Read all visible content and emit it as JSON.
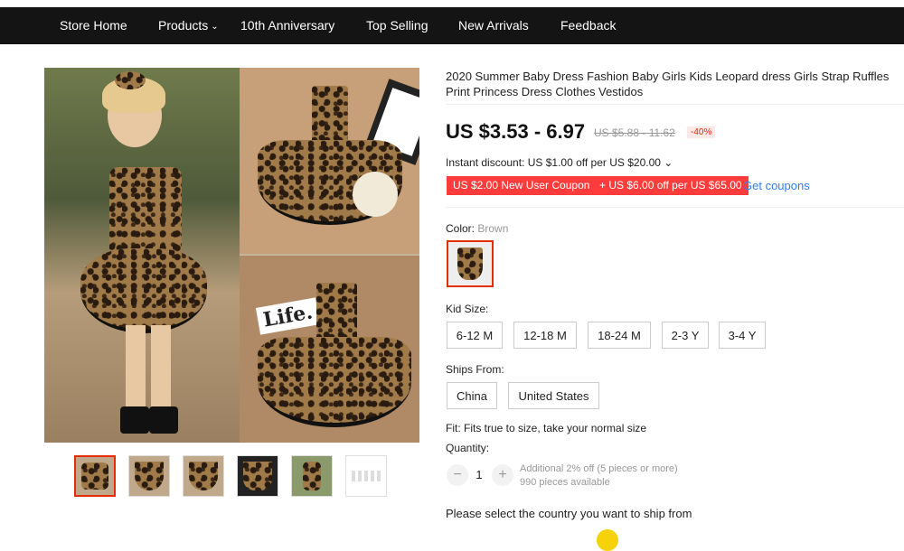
{
  "nav": {
    "items": [
      "Store Home",
      "Products",
      "10th Anniversary",
      "Top Selling",
      "New Arrivals",
      "Feedback"
    ]
  },
  "gallery": {
    "main_overlay_text": "Life.",
    "thumb_count": 6
  },
  "product": {
    "title": "2020 Summer Baby Dress Fashion Baby Girls Kids Leopard dress Girls Strap Ruffles Print Princess Dress Clothes Vestidos",
    "price": "US $3.53 - 6.97",
    "original_price": "US $5.88 - 11.62",
    "discount": "-40%",
    "instant_discount": "Instant discount: US $1.00 off per US $20.00 ⌄",
    "coupons": [
      "US $2.00 New User Coupon",
      "+ US $6.00 off per US $65.00"
    ],
    "get_coupons": "Get coupons"
  },
  "options": {
    "color_label": "Color:",
    "color_value": "Brown",
    "size_label": "Kid Size:",
    "sizes": [
      "6-12 M",
      "12-18 M",
      "18-24 M",
      "2-3 Y",
      "3-4 Y"
    ],
    "ships_from_label": "Ships From:",
    "ships_from": [
      "China",
      "United States"
    ],
    "fit": "Fit: Fits true to size, take your normal size"
  },
  "quantity": {
    "label": "Quantity:",
    "value": "1",
    "minus": "−",
    "plus": "+",
    "note_line1": "Additional 2% off (5 pieces or more)",
    "note_line2": "990 pieces available"
  },
  "ship_prompt": "Please select the country you want to ship from",
  "colors": {
    "accent": "#e62e04",
    "coupon": "#ff3c3c",
    "link": "#2f7ef5",
    "nav_bg": "#141414"
  }
}
